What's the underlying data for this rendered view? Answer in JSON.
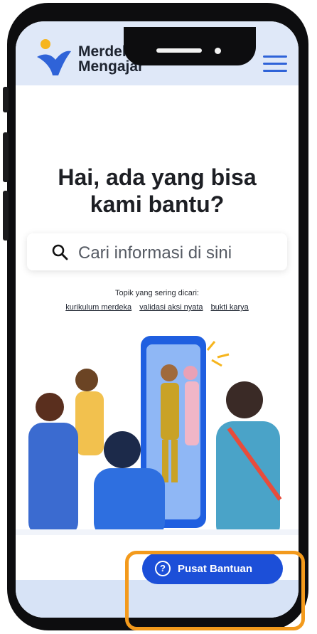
{
  "header": {
    "brand_line1": "Merdeka",
    "brand_line2": "Mengajar"
  },
  "hero": {
    "title_line1": "Hai, ada yang bisa",
    "title_line2": "kami bantu?"
  },
  "search": {
    "placeholder": "Cari informasi di sini"
  },
  "topics": {
    "label": "Topik yang sering dicari:",
    "links": [
      "kurikulum merdeka",
      "validasi aksi nyata",
      "bukti karya"
    ]
  },
  "help_button": {
    "label": "Pusat Bantuan"
  },
  "colors": {
    "accent": "#1c4fd8",
    "highlight": "#f39a1c",
    "header_bg": "#dfe8f8"
  }
}
